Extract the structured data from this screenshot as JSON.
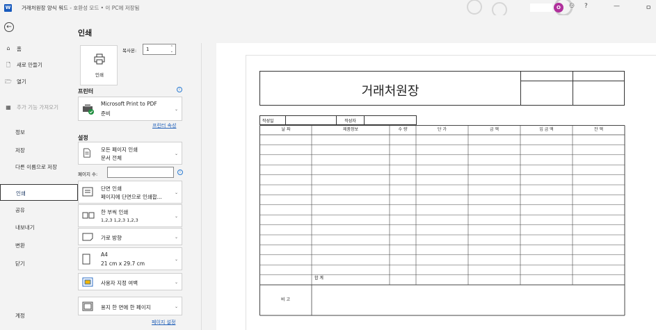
{
  "titlebar": {
    "app_icon": "W",
    "title": "거래처원장 양식 워드",
    "status": " - 호환성 모드 • 이 PC에 저장됨",
    "avatar_initial": "O",
    "help": "?",
    "minimize": "—",
    "restore": "ㅁ"
  },
  "nav": {
    "back": "←",
    "items": [
      {
        "icon": "⌂",
        "label": "홈"
      },
      {
        "icon": "🗋",
        "label": "새로 만들기"
      },
      {
        "icon": "🗁",
        "label": "열기"
      },
      {
        "icon": "▦",
        "label": "추가 기능 가져오기"
      },
      {
        "label": "정보"
      },
      {
        "label": "저장"
      },
      {
        "label": "다른 이름으로 저장"
      },
      {
        "label": "인쇄"
      },
      {
        "label": "공유"
      },
      {
        "label": "내보내기"
      },
      {
        "label": "변환"
      },
      {
        "label": "닫기"
      },
      {
        "label": "계정"
      }
    ]
  },
  "print": {
    "title": "인쇄",
    "button_label": "인쇄",
    "copies_label": "복사본:",
    "copies_value": "1",
    "printer_section": "프린터",
    "printer_name": "Microsoft Print to PDF",
    "printer_status": "준비",
    "printer_props": "프린터 속성",
    "settings_section": "설정",
    "range_l1": "모든 페이지 인쇄",
    "range_l2": "문서 전체",
    "pages_label": "페이지 수:",
    "pages_value": "",
    "sides_l1": "단면 인쇄",
    "sides_l2": "페이지에 단면으로 인쇄합...",
    "collate_l1": "한 부씩 인쇄",
    "collate_l2": "1,2,3    1,2,3    1,2,3",
    "orientation": "가로 방향",
    "paper_l1": "A4",
    "paper_l2": "21 cm x 29.7 cm",
    "margins": "사용자 지정 여백",
    "per_sheet": "용지 한 면에 한 페이지",
    "page_setup": "페이지 설정"
  },
  "doc": {
    "title": "거래처원장",
    "meta_date_label": "작성일",
    "meta_author_label": "작성자",
    "headers": [
      "날    짜",
      "제품정보",
      "수    량",
      "단    가",
      "금    액",
      "입 금 액",
      "잔    액"
    ],
    "sum_label": "합    계",
    "remark_label": "비    고"
  }
}
